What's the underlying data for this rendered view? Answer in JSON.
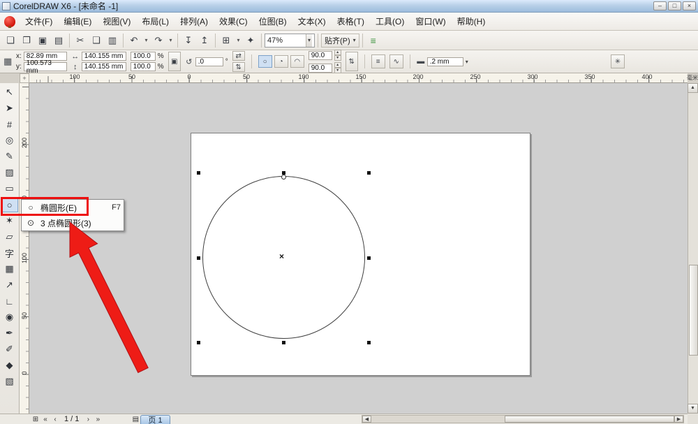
{
  "icons": {
    "minimize": "–",
    "maximize": "□",
    "close": "×",
    "dropdown": "▾",
    "spinner_up": "▴",
    "spinner_down": "▾",
    "scroll_up": "▲",
    "scroll_down": "▼",
    "scroll_left": "◀",
    "scroll_right": "▶",
    "nav_first": "«",
    "nav_prev": "‹",
    "nav_next": "›",
    "nav_last": "»",
    "add_page": "⊞",
    "pages": "▤",
    "pos_grid": "▦",
    "width": "↔",
    "height": "↕",
    "lock": "▣",
    "rotate": "↺",
    "degree": "°",
    "mirror_h": "⇄",
    "mirror_v": "⇅",
    "ellipse_mode": "○",
    "pie_mode": "◔",
    "arc_mode": "◠",
    "swap": "⇅",
    "wrap": "≡",
    "curves": "∿",
    "outline_line": "▬",
    "wheel": "✳",
    "origin": "+"
  },
  "titlebar": {
    "title": "CorelDRAW X6 - [未命名 -1]"
  },
  "menu": {
    "items": [
      "文件(F)",
      "编辑(E)",
      "视图(V)",
      "布局(L)",
      "排列(A)",
      "效果(C)",
      "位图(B)",
      "文本(X)",
      "表格(T)",
      "工具(O)",
      "窗口(W)",
      "帮助(H)"
    ]
  },
  "toolbar": {
    "buttons": [
      {
        "name": "new-document",
        "glyph": "❏"
      },
      {
        "name": "open",
        "glyph": "❐"
      },
      {
        "name": "save",
        "glyph": "▣"
      },
      {
        "name": "print",
        "glyph": "▤"
      },
      {
        "name": "cut",
        "glyph": "✂"
      },
      {
        "name": "copy",
        "glyph": "❑"
      },
      {
        "name": "paste",
        "glyph": "▥"
      },
      {
        "name": "undo",
        "glyph": "↶"
      },
      {
        "name": "redo",
        "glyph": "↷"
      },
      {
        "name": "import",
        "glyph": "↧"
      },
      {
        "name": "export",
        "glyph": "↥"
      },
      {
        "name": "app-launcher",
        "glyph": "⊞"
      },
      {
        "name": "welcome-screen",
        "glyph": "✦"
      }
    ],
    "zoom_value": "47%",
    "snap_label": "贴齐(P)",
    "options_glyph": "≡"
  },
  "property_bar": {
    "x_label": "x:",
    "x_value": "82.89 mm",
    "y_label": "y:",
    "y_value": "100.573 mm",
    "width_value": "140.155 mm",
    "height_value": "140.155 mm",
    "scale_x": "100.0",
    "scale_y": "100.0",
    "percent_x": "%",
    "percent_y": "%",
    "rotation_value": ".0",
    "arc_start": "90.0",
    "arc_end": "90.0",
    "outline_width": ".2 mm"
  },
  "toolbox": {
    "tools": [
      {
        "name": "pick-tool",
        "glyph": "↖"
      },
      {
        "name": "shape-tool",
        "glyph": "➤"
      },
      {
        "name": "crop-tool",
        "glyph": "#"
      },
      {
        "name": "zoom-tool",
        "glyph": "◎"
      },
      {
        "name": "freehand-tool",
        "glyph": "✎"
      },
      {
        "name": "smart-fill-tool",
        "glyph": "▨"
      },
      {
        "name": "rectangle-tool",
        "glyph": "▭"
      },
      {
        "name": "ellipse-tool",
        "glyph": "○"
      },
      {
        "name": "polygon-tool",
        "glyph": "✶"
      },
      {
        "name": "basic-shapes-tool",
        "glyph": "▱"
      },
      {
        "name": "text-tool",
        "glyph": "字"
      },
      {
        "name": "table-tool",
        "glyph": "▦"
      },
      {
        "name": "dimension-tool",
        "glyph": "↗"
      },
      {
        "name": "connector-tool",
        "glyph": "∟"
      },
      {
        "name": "blend-tool",
        "glyph": "◉"
      },
      {
        "name": "eyedropper-tool",
        "glyph": "✒"
      },
      {
        "name": "outline-pen-tool",
        "glyph": "✐"
      },
      {
        "name": "fill-tool",
        "glyph": "◆"
      },
      {
        "name": "interactive-fill-tool",
        "glyph": "▧"
      }
    ]
  },
  "flyout": {
    "items": [
      {
        "glyph": "○",
        "label": "椭圆形(E)",
        "shortcut": "F7"
      },
      {
        "glyph": "⊙",
        "label": "3 点椭圆形(3)",
        "shortcut": ""
      }
    ]
  },
  "rulers": {
    "h_labels": [
      "100",
      "50",
      "0",
      "50",
      "100",
      "150",
      "200",
      "250",
      "300",
      "350",
      "400"
    ],
    "v_labels": [
      "200",
      "150",
      "100",
      "50",
      "0"
    ],
    "units": "毫米"
  },
  "statusbar": {
    "page_indicator": "1 / 1",
    "page_tab": "页 1"
  }
}
